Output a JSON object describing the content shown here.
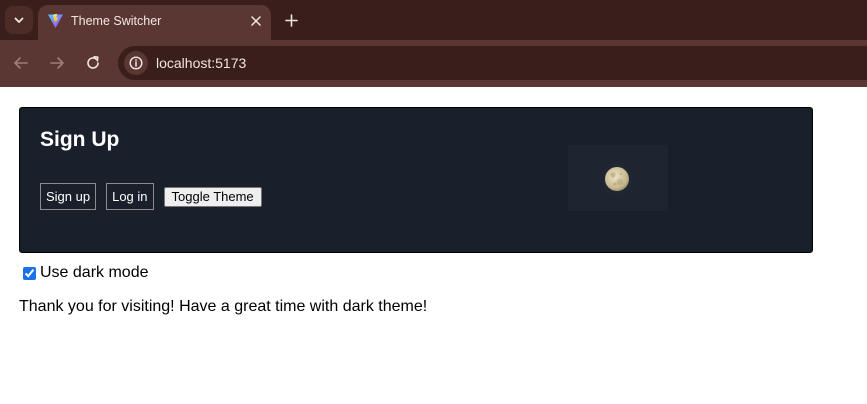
{
  "browser": {
    "tab": {
      "title": "Theme Switcher",
      "active": true
    },
    "address": "localhost:5173",
    "icons": {
      "tab_menu": "chevron-down-icon",
      "favicon": "vite-icon",
      "tab_close": "close-icon",
      "new_tab": "plus-icon",
      "back": "back-arrow-icon",
      "forward": "forward-arrow-icon",
      "reload": "reload-icon",
      "site_info": "info-icon"
    },
    "colors": {
      "frame": "#3a1e1b",
      "toolbar": "#5a3733"
    }
  },
  "page": {
    "card": {
      "title": "Sign Up",
      "buttons": {
        "signup": "Sign up",
        "login": "Log in",
        "toggle": "Toggle Theme"
      },
      "image": "moon-image",
      "background": "#19202b"
    },
    "dark_mode": {
      "label": "Use dark mode",
      "checked": true
    },
    "message": "Thank you for visiting! Have a great time with dark theme!"
  }
}
